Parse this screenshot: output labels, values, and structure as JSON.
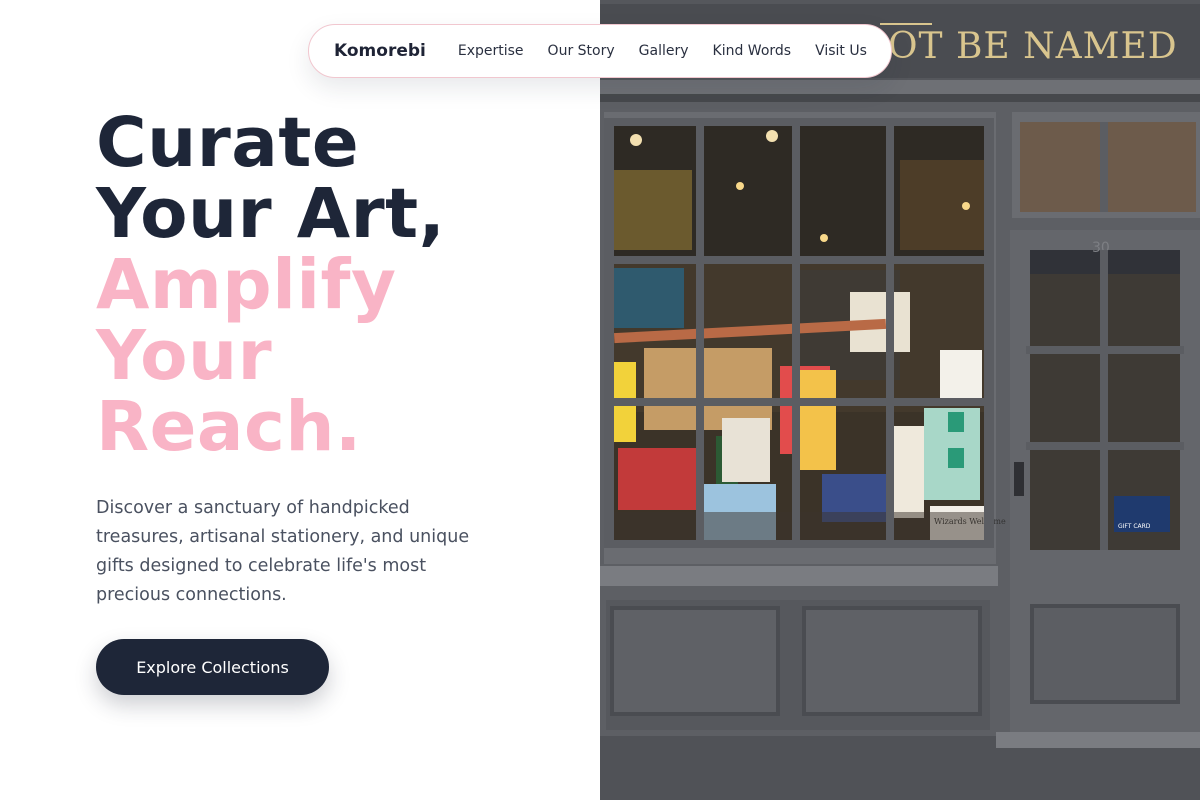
{
  "nav": {
    "brand": "Komorebi",
    "links": [
      "Expertise",
      "Our Story",
      "Gallery",
      "Kind Words",
      "Visit Us"
    ]
  },
  "hero": {
    "line1": "Curate",
    "line2": "Your Art,",
    "line3": "Amplify",
    "line4": "Your",
    "line5": "Reach.",
    "description": "Discover a sanctuary of handpicked treasures, artisanal stationery, and unique gifts designed to celebrate life's most precious connections.",
    "cta_label": "Explore Collections"
  },
  "storefront": {
    "sign_text": "OT BE NAMED",
    "door_number": "30",
    "window_sign": "Wizards Welcome",
    "gift_card": "GIFT CARD"
  },
  "colors": {
    "dark": "#1e2638",
    "accent_pink": "#f9b4c6",
    "storefront_gray": "#5d5f64"
  }
}
